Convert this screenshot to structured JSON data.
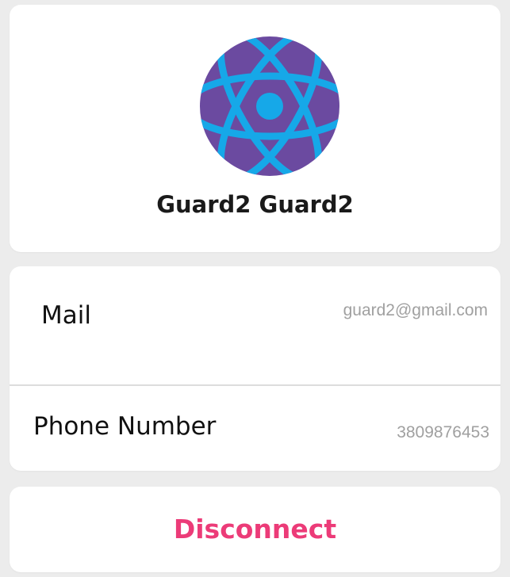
{
  "profile": {
    "name": "Guard2 Guard2",
    "avatar_icon": "atom-icon",
    "avatar_colors": {
      "background": "#6b4aa0",
      "accent": "#16a8e8"
    }
  },
  "details": {
    "mail": {
      "label": "Mail",
      "value": "guard2@gmail.com"
    },
    "phone": {
      "label": "Phone Number",
      "value": "3809876453"
    }
  },
  "actions": {
    "disconnect_label": "Disconnect",
    "disconnect_color": "#ec3b78"
  }
}
